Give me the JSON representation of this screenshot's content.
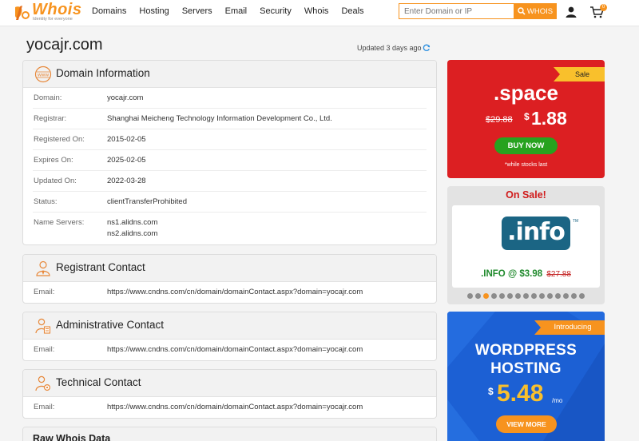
{
  "header": {
    "logo_text": "Whois",
    "logo_tagline": "Identity for everyone",
    "nav": [
      "Domains",
      "Hosting",
      "Servers",
      "Email",
      "Security",
      "Whois",
      "Deals"
    ],
    "search_placeholder": "Enter Domain or IP",
    "search_button": "WHOIS",
    "cart_count": "0",
    "accent_color": "#f7931e"
  },
  "page": {
    "domain": "yocajr.com",
    "updated": "Updated 3 days ago"
  },
  "domain_info": {
    "title": "Domain Information",
    "rows": [
      {
        "label": "Domain:",
        "value": "yocajr.com"
      },
      {
        "label": "Registrar:",
        "value": "Shanghai Meicheng Technology Information Development Co., Ltd."
      },
      {
        "label": "Registered On:",
        "value": "2015-02-05"
      },
      {
        "label": "Expires On:",
        "value": "2025-02-05"
      },
      {
        "label": "Updated On:",
        "value": "2022-03-28"
      },
      {
        "label": "Status:",
        "value": "clientTransferProhibited"
      },
      {
        "label": "Name Servers:",
        "values": [
          "ns1.alidns.com",
          "ns2.alidns.com"
        ]
      }
    ]
  },
  "registrant": {
    "title": "Registrant Contact",
    "label": "Email:",
    "value": "https://www.cndns.com/cn/domain/domainContact.aspx?domain=yocajr.com"
  },
  "administrative": {
    "title": "Administrative Contact",
    "label": "Email:",
    "value": "https://www.cndns.com/cn/domain/domainContact.aspx?domain=yocajr.com"
  },
  "technical": {
    "title": "Technical Contact",
    "label": "Email:",
    "value": "https://www.cndns.com/cn/domain/domainContact.aspx?domain=yocajr.com"
  },
  "raw": {
    "title": "Raw Whois Data"
  },
  "ads": {
    "space": {
      "tag": "Sale",
      "name": ".space",
      "old_price": "$29.88",
      "currency": "$",
      "price": "1.88",
      "button": "BUY NOW",
      "note": "*while stocks last"
    },
    "onsale": {
      "title": "On Sale!",
      "logo_text": ".info",
      "tm": "TM",
      "price": ".INFO @ $3.98",
      "old_price": "$27.88",
      "slides": 15,
      "active_slide": 2
    },
    "wordpress": {
      "tag": "Introducing",
      "line1": "WORDPRESS",
      "line2": "HOSTING",
      "currency": "$",
      "price": "5.48",
      "period": "/mo",
      "button": "VIEW MORE"
    }
  }
}
